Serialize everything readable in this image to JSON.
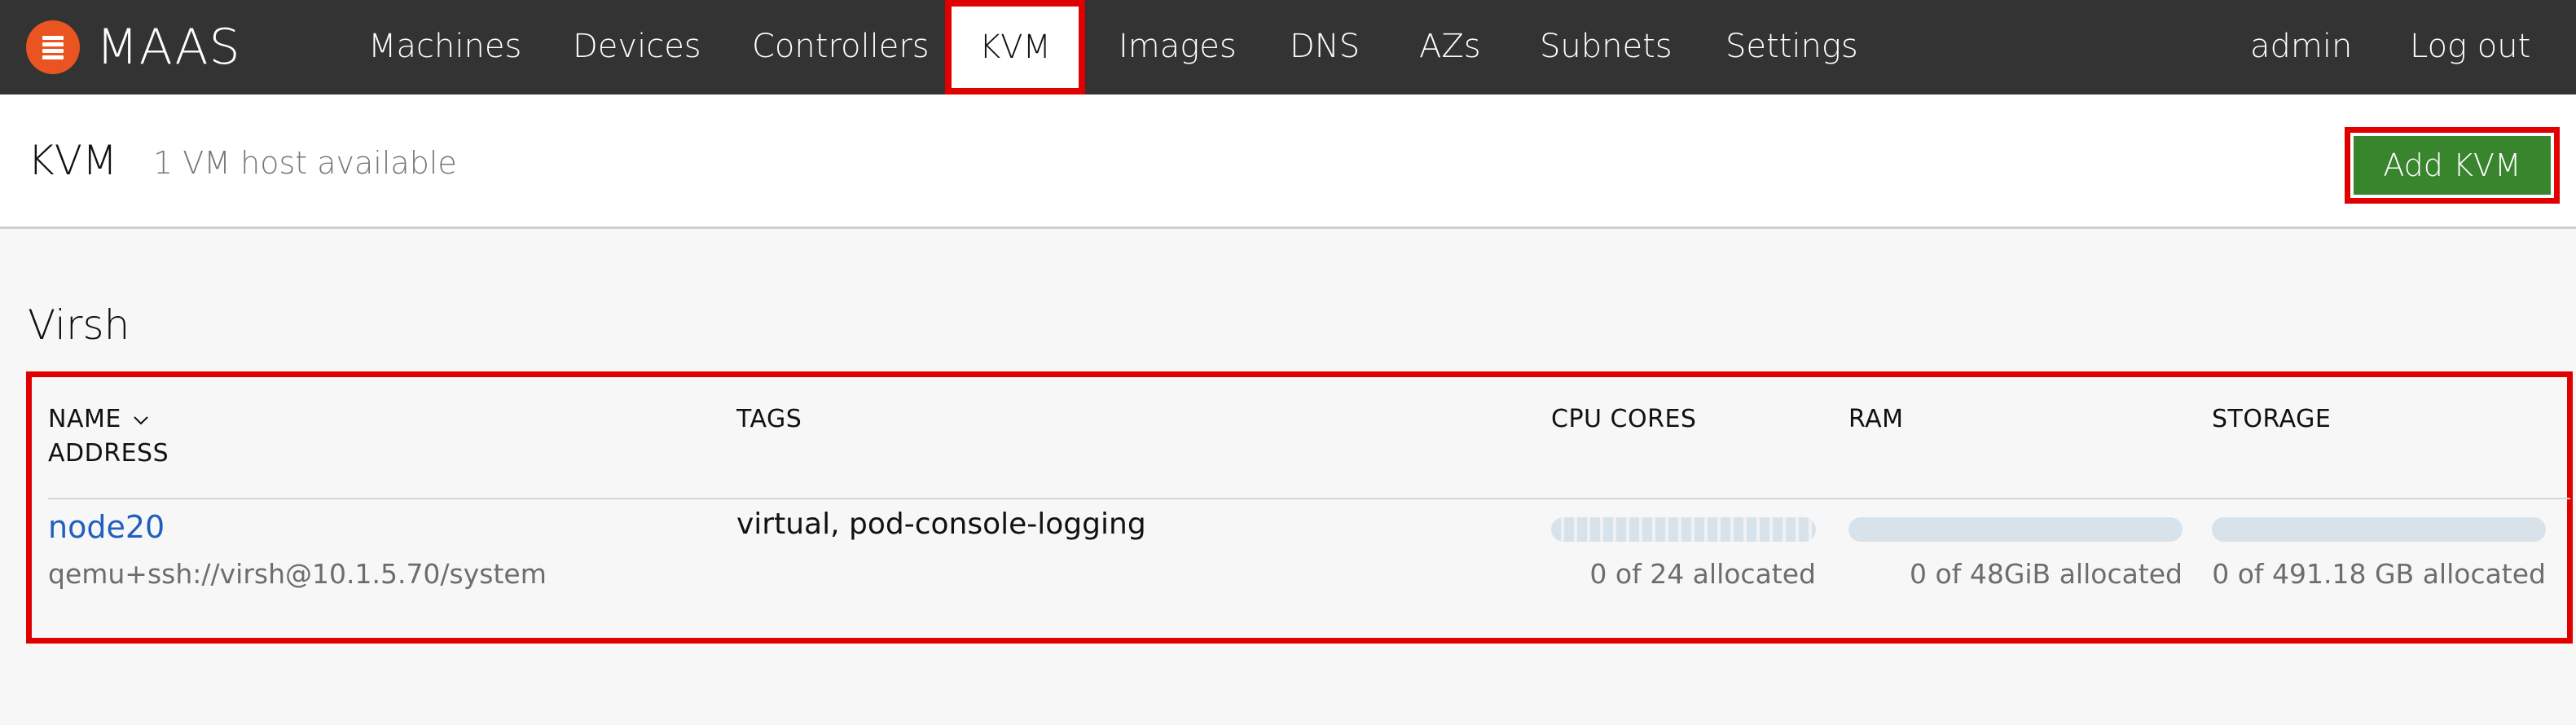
{
  "app": {
    "name": "MAAS",
    "brand_color": "#e95420",
    "logo_icon": "maas-logo-icon"
  },
  "nav": {
    "items": [
      {
        "label": "Machines"
      },
      {
        "label": "Devices"
      },
      {
        "label": "Controllers"
      },
      {
        "label": "KVM",
        "active": true
      },
      {
        "label": "Images"
      },
      {
        "label": "DNS"
      },
      {
        "label": "AZs"
      },
      {
        "label": "Subnets"
      },
      {
        "label": "Settings"
      }
    ],
    "user": "admin",
    "logout": "Log out"
  },
  "header": {
    "title": "KVM",
    "subtitle": "1 VM host available",
    "add_button": "Add KVM",
    "add_button_color": "#38852d"
  },
  "section": {
    "title": "Virsh"
  },
  "table": {
    "columns": {
      "name": "NAME",
      "address": "ADDRESS",
      "tags": "TAGS",
      "cpu": "CPU CORES",
      "ram": "RAM",
      "storage": "STORAGE"
    },
    "sort_icon": "chevron-down-icon",
    "rows": [
      {
        "name": "node20",
        "address": "qemu+ssh://virsh@10.1.5.70/system",
        "tags": "virtual, pod-console-logging",
        "cpu_alloc": "0 of 24 allocated",
        "cpu_fraction": 0,
        "ram_alloc": "0 of 48GiB allocated",
        "ram_fraction": 0,
        "storage_alloc": "0 of 491.18 GB allocated",
        "storage_fraction": 0
      }
    ]
  },
  "highlight_color": "#e00000"
}
